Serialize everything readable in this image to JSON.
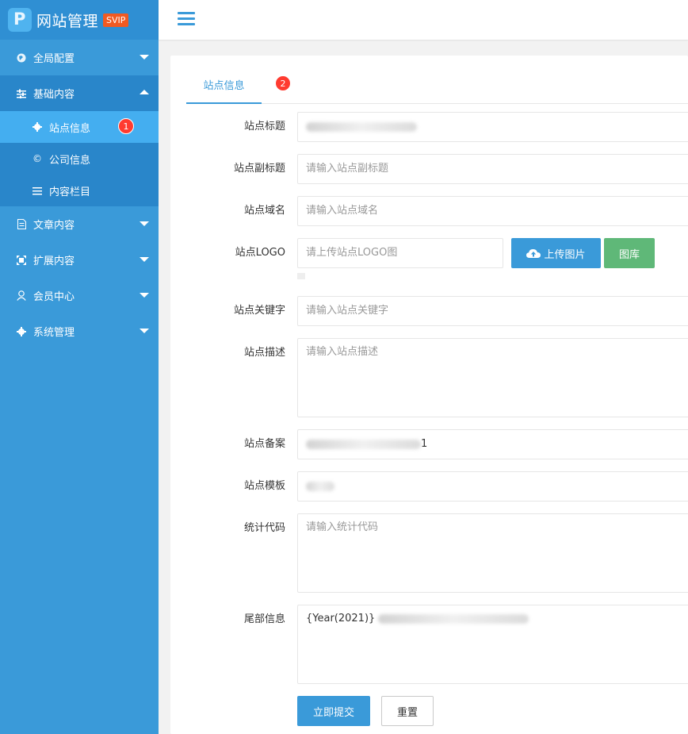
{
  "sidebar": {
    "brand": "网站管理",
    "brand_badge": "SVIP",
    "menu": [
      {
        "label": "全局配置",
        "icon": "globe-icon"
      },
      {
        "label": "基础内容",
        "icon": "sliders-icon"
      },
      {
        "label": "文章内容",
        "icon": "document-icon"
      },
      {
        "label": "扩展内容",
        "icon": "expand-icon"
      },
      {
        "label": "会员中心",
        "icon": "user-icon"
      },
      {
        "label": "系统管理",
        "icon": "gear-icon"
      }
    ],
    "submenu": [
      {
        "label": "站点信息",
        "icon": "gear-icon",
        "badge": "1"
      },
      {
        "label": "公司信息",
        "icon": "copyright-icon"
      },
      {
        "label": "内容栏目",
        "icon": "list-icon"
      }
    ]
  },
  "tab": {
    "label": "站点信息",
    "badge": "2"
  },
  "form": {
    "site_title": {
      "label": "站点标题",
      "value": ""
    },
    "site_subtitle": {
      "label": "站点副标题",
      "placeholder": "请输入站点副标题"
    },
    "site_domain": {
      "label": "站点域名",
      "placeholder": "请输入站点域名"
    },
    "site_logo": {
      "label": "站点LOGO",
      "placeholder": "请上传站点LOGO图",
      "upload_label": "上传图片",
      "library_label": "图库"
    },
    "site_keywords": {
      "label": "站点关键字",
      "placeholder": "请输入站点关键字"
    },
    "site_description": {
      "label": "站点描述",
      "placeholder": "请输入站点描述"
    },
    "site_icp": {
      "label": "站点备案",
      "value_suffix": "1"
    },
    "site_template": {
      "label": "站点模板"
    },
    "stat_code": {
      "label": "统计代码",
      "placeholder": "请输入统计代码"
    },
    "footer_info": {
      "label": "尾部信息",
      "value_prefix": "{Year(2021)}"
    },
    "submit_label": "立即提交",
    "reset_label": "重置"
  },
  "colors": {
    "primary": "#3a9ad9",
    "success": "#5fb878",
    "badge": "#ff3b30",
    "svip": "#f15a22"
  }
}
